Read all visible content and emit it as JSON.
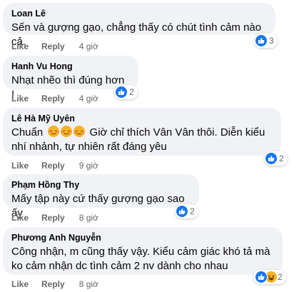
{
  "actions": {
    "like_label": "Like",
    "reply_label": "Reply"
  },
  "comments": [
    {
      "author": "Loan Lê",
      "text": "Sến và gượng gạo, chẳng thấy có chút tình cảm nào cả.",
      "time": "4 giờ",
      "reaction_count": "3"
    },
    {
      "author": "Hanh Vu Hong",
      "text": "Nhạt nhẽo thì đúng hơn !",
      "time": "4 giờ",
      "reaction_count": "2"
    },
    {
      "author": "Lê Hà Mỹ Uyên",
      "text_before": "Chuẩn",
      "text_after": "Giờ chỉ thích Vân Vân thôi. Diễn kiểu nhí nhảnh, tự nhiên rất đáng yêu",
      "time": "9 giờ",
      "reaction_count": "2",
      "emojis": [
        "smiling-blush-emoji",
        "smiling-blush-emoji",
        "smiling-blush-emoji"
      ]
    },
    {
      "author": "Phạm Hồng Thy",
      "text": "Mấy tập này cứ thấy gượng gạo sao ấy",
      "time": "8 giờ",
      "reaction_count": "2"
    },
    {
      "author": "Phương Anh Nguyễn",
      "text": "Công nhận, m cũng thấy vậy. Kiểu cảm giác khó tả mà ko cảm nhận dc tình cảm 2 nv dành cho nhau",
      "time": "8 giờ",
      "reaction_count": "2"
    }
  ],
  "colors": {
    "bubble": "#f0f2f5",
    "like_blue": "#1877f2",
    "meta_gray": "#65676b",
    "haha_yellow": "#f7b125"
  }
}
